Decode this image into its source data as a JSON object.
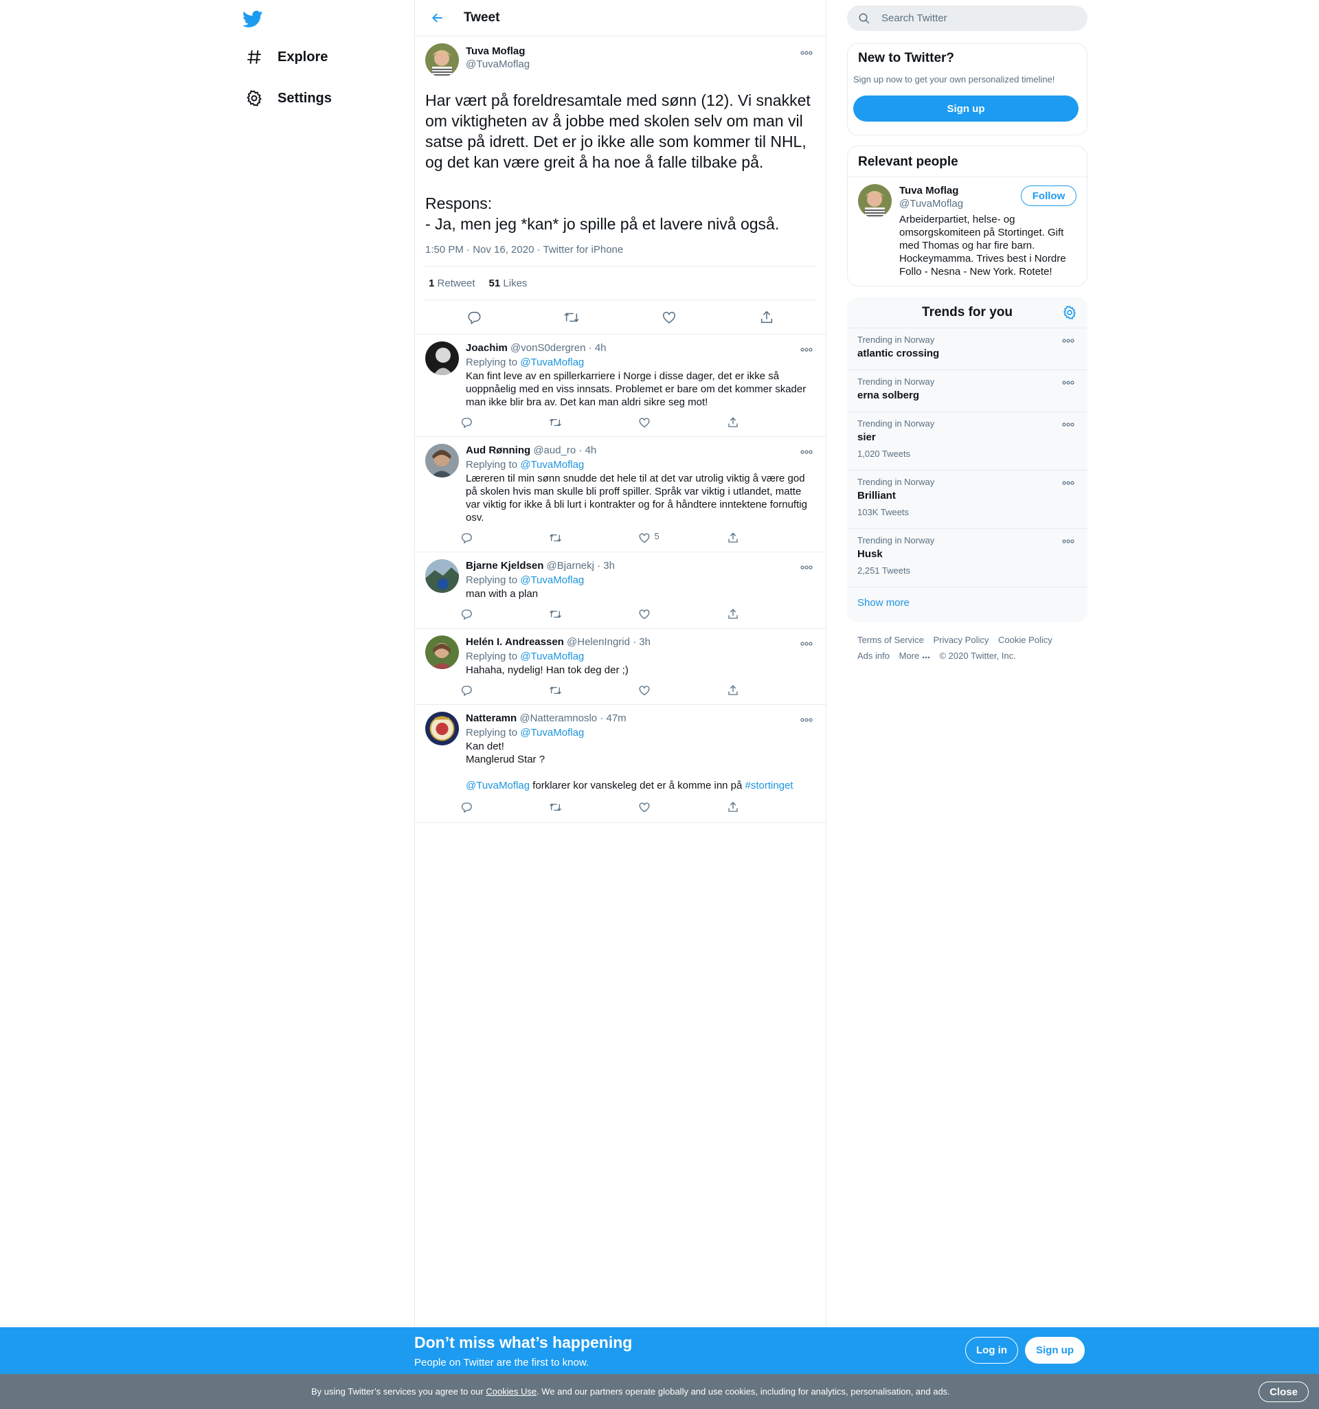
{
  "colors": {
    "accent": "#1d9bf0",
    "link": "#1b95e0",
    "muted": "#5b7083",
    "cookie_bar": "#66757f"
  },
  "nav": {
    "logo": "twitter-bird-icon",
    "items": [
      {
        "label": "Explore",
        "icon": "hashtag-icon"
      },
      {
        "label": "Settings",
        "icon": "gear-icon"
      }
    ]
  },
  "header": {
    "title": "Tweet"
  },
  "tweet": {
    "display_name": "Tuva Moflag",
    "username": "@TuvaMoflag",
    "text": "Har vært på foreldresamtale med sønn (12). Vi snakket om viktigheten av å jobbe med skolen selv om man vil satse på idrett. Det er jo ikke alle som kommer til NHL, og det kan være greit å ha noe å falle tilbake på.\n\nRespons:\n- Ja, men jeg *kan* jo spille på et lavere nivå også.",
    "time": "1:50 PM · Nov 16, 2020",
    "source": "Twitter for iPhone",
    "retweets_count": "1",
    "retweets_label": "Retweet",
    "likes_count": "51",
    "likes_label": "Likes"
  },
  "replies": [
    {
      "name": "Joachim",
      "handle": "@vonS0dergren",
      "time": "· 4h",
      "replying_label": "Replying to",
      "replying_to": "@TuvaMoflag",
      "text": "Kan fint leve av en spillerkarriere i Norge i disse dager, det er ikke så uoppnåelig med en viss innsats. Problemet er bare om det kommer skader man ikke blir bra av. Det kan man aldri sikre seg mot!",
      "likes": ""
    },
    {
      "name": "Aud Rønning",
      "handle": "@aud_ro",
      "time": "· 4h",
      "replying_label": "Replying to",
      "replying_to": "@TuvaMoflag",
      "text": "Læreren til min sønn snudde det hele til at det var utrolig viktig å være god på skolen hvis man skulle bli proff spiller. Språk var viktig i utlandet, matte var viktig for ikke å bli lurt i kontrakter og for å håndtere inntektene fornuftig osv.",
      "likes": "5"
    },
    {
      "name": "Bjarne Kjeldsen",
      "handle": "@Bjarnekj",
      "time": "· 3h",
      "replying_label": "Replying to",
      "replying_to": "@TuvaMoflag",
      "text": "man with a plan",
      "likes": ""
    },
    {
      "name": "Helén I. Andreassen",
      "handle": "@HelenIngrid",
      "time": "· 3h",
      "replying_label": "Replying to",
      "replying_to": "@TuvaMoflag",
      "text": "Hahaha, nydelig! Han tok deg der ;)",
      "likes": ""
    },
    {
      "name": "Natteramn",
      "handle": "@Natteramnoslo",
      "time": "· 47m",
      "replying_label": "Replying to",
      "replying_to": "@TuvaMoflag",
      "text": "Kan det!\nManglerud Star ?\n\n",
      "mention": "@TuvaMoflag",
      "text_after": " forklarer kor vanskeleg det er å komme inn på ",
      "hashtag": "#stortinget",
      "likes": ""
    }
  ],
  "search": {
    "placeholder": "Search Twitter"
  },
  "new_to_twitter": {
    "title": "New to Twitter?",
    "subtitle": "Sign up now to get your own personalized timeline!",
    "button": "Sign up"
  },
  "relevant": {
    "title": "Relevant people",
    "name": "Tuva Moflag",
    "handle": "@TuvaMoflag",
    "follow": "Follow",
    "bio": "Arbeiderpartiet, helse- og omsorgskomiteen på Stortinget. Gift med Thomas og har fire barn. Hockeymamma. Trives best i Nordre Follo - Nesna - New York. Rotete!"
  },
  "trends": {
    "title": "Trends for you",
    "items": [
      {
        "context": "Trending in Norway",
        "name": "atlantic crossing",
        "count": ""
      },
      {
        "context": "Trending in Norway",
        "name": "erna solberg",
        "count": ""
      },
      {
        "context": "Trending in Norway",
        "name": "sier",
        "count": "1,020 Tweets"
      },
      {
        "context": "Trending in Norway",
        "name": "Brilliant",
        "count": "103K Tweets"
      },
      {
        "context": "Trending in Norway",
        "name": "Husk",
        "count": "2,251 Tweets"
      }
    ],
    "show_more": "Show more"
  },
  "footer": {
    "terms": "Terms of Service",
    "privacy": "Privacy Policy",
    "cookie": "Cookie Policy",
    "ads": "Ads info",
    "more": "More",
    "copyright": "© 2020 Twitter, Inc."
  },
  "bottom_bar": {
    "title": "Don’t miss what’s happening",
    "subtitle": "People on Twitter are the first to know.",
    "login": "Log in",
    "signup": "Sign up"
  },
  "cookie_bar": {
    "text_before": "By using Twitter’s services you agree to our ",
    "link": "Cookies Use",
    "text_after": ". We and our partners operate globally and use cookies, including for analytics, personalisation, and ads.",
    "close": "Close"
  }
}
